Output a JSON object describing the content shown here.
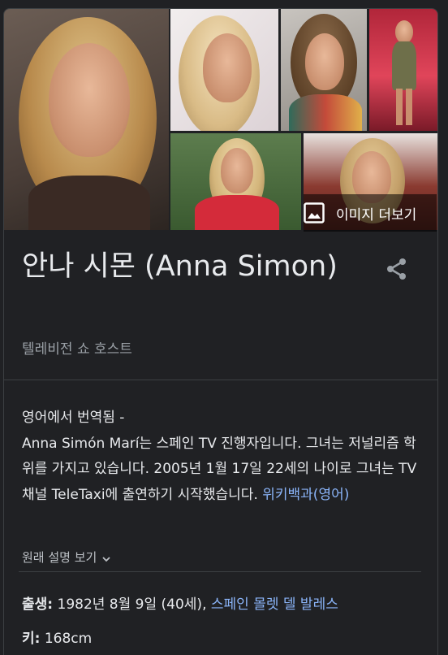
{
  "images": {
    "more_images_label": "이미지 더보기"
  },
  "entity": {
    "title": "안나 시몬 (Anna Simon)",
    "subtitle": "텔레비전 쇼 호스트"
  },
  "description": {
    "translated_label": "영어에서 번역됨 -",
    "text": "Anna Simón Marí는 스페인 TV 진행자입니다. 그녀는 저널리즘 학위를 가지고 있습니다. 2005년 1월 17일 22세의 나이로 그녀는 TV 채널 TeleTaxi에 출연하기 시작했습니다.",
    "source_link": "위키백과(영어)",
    "show_original": "원래 설명 보기"
  },
  "facts": {
    "born_label": "출생:",
    "born_value": "1982년 8월 9일 (40세),",
    "born_place": "스페인 몰렛 델 발레스",
    "height_label": "키:",
    "height_value": "168cm"
  },
  "icons": {
    "image": "image-icon",
    "share": "share-icon",
    "chevron": "chevron-down-icon"
  },
  "colors": {
    "background": "#202124",
    "link": "#8ab4f8",
    "muted": "#9aa0a6"
  }
}
